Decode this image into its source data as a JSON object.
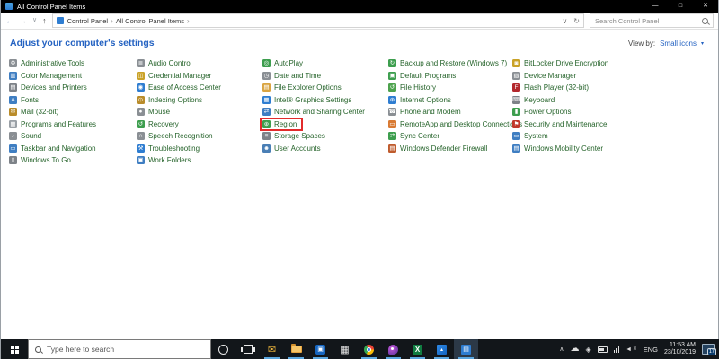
{
  "titlebar": {
    "title": "All Control Panel Items"
  },
  "glyphs": {
    "back": "←",
    "forward": "→",
    "nav_dropdown": "∨",
    "up": "↑",
    "address_dropdown": "∨",
    "refresh": "↻",
    "crumb_sep": "›",
    "minimize": "—",
    "maximize": "□",
    "close": "✕",
    "view_caret": "▾",
    "tray_chevron": "∧"
  },
  "addressbar": {
    "crumbs": [
      "Control Panel",
      "All Control Panel Items"
    ],
    "search_placeholder": "Search Control Panel"
  },
  "header": {
    "title": "Adjust your computer's settings",
    "view_by_label": "View by:",
    "view_by_value": "Small icons"
  },
  "colors": {
    "item_text": "#25632a",
    "link_blue": "#2563c2",
    "highlight_red": "#e22b2b",
    "running_indicator": "#5ba7e0",
    "taskbar_bg": "#12161a"
  },
  "panel": {
    "highlighted": "Region",
    "columns": [
      {
        "items": [
          {
            "label": "Administrative Tools",
            "icon": "administrative-tools-icon"
          },
          {
            "label": "Color Management",
            "icon": "color-management-icon"
          },
          {
            "label": "Devices and Printers",
            "icon": "devices-and-printers-icon"
          },
          {
            "label": "Fonts",
            "icon": "fonts-icon"
          },
          {
            "label": "Mail (32-bit)",
            "icon": "mail-32bit-icon"
          },
          {
            "label": "Programs and Features",
            "icon": "programs-and-features-icon"
          },
          {
            "label": "Sound",
            "icon": "sound-icon"
          },
          {
            "label": "Taskbar and Navigation",
            "icon": "taskbar-navigation-icon"
          },
          {
            "label": "Windows To Go",
            "icon": "windows-to-go-icon"
          }
        ]
      },
      {
        "items": [
          {
            "label": "Audio Control",
            "icon": "audio-control-icon"
          },
          {
            "label": "Credential Manager",
            "icon": "credential-manager-icon"
          },
          {
            "label": "Ease of Access Center",
            "icon": "ease-of-access-icon"
          },
          {
            "label": "Indexing Options",
            "icon": "indexing-options-icon"
          },
          {
            "label": "Mouse",
            "icon": "mouse-icon"
          },
          {
            "label": "Recovery",
            "icon": "recovery-icon"
          },
          {
            "label": "Speech Recognition",
            "icon": "speech-recognition-icon"
          },
          {
            "label": "Troubleshooting",
            "icon": "troubleshooting-icon"
          },
          {
            "label": "Work Folders",
            "icon": "work-folders-icon"
          }
        ]
      },
      {
        "items": [
          {
            "label": "AutoPlay",
            "icon": "autoplay-icon"
          },
          {
            "label": "Date and Time",
            "icon": "date-and-time-icon"
          },
          {
            "label": "File Explorer Options",
            "icon": "file-explorer-options-icon"
          },
          {
            "label": "Intel® Graphics Settings",
            "icon": "intel-graphics-icon"
          },
          {
            "label": "Network and Sharing Center",
            "icon": "network-sharing-icon"
          },
          {
            "label": "Region",
            "icon": "region-icon"
          },
          {
            "label": "Storage Spaces",
            "icon": "storage-spaces-icon"
          },
          {
            "label": "User Accounts",
            "icon": "user-accounts-icon"
          }
        ]
      },
      {
        "items": [
          {
            "label": "Backup and Restore (Windows 7)",
            "icon": "backup-restore-icon"
          },
          {
            "label": "Default Programs",
            "icon": "default-programs-icon"
          },
          {
            "label": "File History",
            "icon": "file-history-icon"
          },
          {
            "label": "Internet Options",
            "icon": "internet-options-icon"
          },
          {
            "label": "Phone and Modem",
            "icon": "phone-modem-icon"
          },
          {
            "label": "RemoteApp and Desktop Connections",
            "icon": "remoteapp-icon"
          },
          {
            "label": "Sync Center",
            "icon": "sync-center-icon"
          },
          {
            "label": "Windows Defender Firewall",
            "icon": "defender-firewall-icon"
          }
        ]
      },
      {
        "items": [
          {
            "label": "BitLocker Drive Encryption",
            "icon": "bitlocker-icon"
          },
          {
            "label": "Device Manager",
            "icon": "device-manager-icon"
          },
          {
            "label": "Flash Player (32-bit)",
            "icon": "flash-player-icon"
          },
          {
            "label": "Keyboard",
            "icon": "keyboard-icon"
          },
          {
            "label": "Power Options",
            "icon": "power-options-icon"
          },
          {
            "label": "Security and Maintenance",
            "icon": "security-maintenance-icon"
          },
          {
            "label": "System",
            "icon": "system-icon"
          },
          {
            "label": "Windows Mobility Center",
            "icon": "mobility-center-icon"
          }
        ]
      }
    ]
  },
  "taskbar": {
    "search_placeholder": "Type here to search",
    "apps": [
      {
        "name": "cortana",
        "icon": "cortana-icon",
        "running": false,
        "active": false
      },
      {
        "name": "task-view",
        "icon": "task-view-icon",
        "running": false,
        "active": false
      },
      {
        "name": "mail",
        "icon": "mail-app-icon",
        "running": true,
        "active": false
      },
      {
        "name": "file-explorer",
        "icon": "file-explorer-icon",
        "running": true,
        "active": false
      },
      {
        "name": "store",
        "icon": "microsoft-store-icon",
        "running": true,
        "active": false
      },
      {
        "name": "calculator",
        "icon": "calculator-icon",
        "running": false,
        "active": false
      },
      {
        "name": "chrome",
        "icon": "chrome-icon",
        "running": true,
        "active": false
      },
      {
        "name": "paint3d",
        "icon": "paint-3d-icon",
        "running": true,
        "active": false
      },
      {
        "name": "excel",
        "icon": "excel-icon",
        "running": true,
        "active": false
      },
      {
        "name": "photos",
        "icon": "photos-icon",
        "running": true,
        "active": false
      },
      {
        "name": "control-panel",
        "icon": "control-panel-taskbar-icon",
        "running": true,
        "active": true
      }
    ],
    "tray": {
      "language": "ENG",
      "time": "11:53 AM",
      "date": "23/10/2019",
      "badge": "17"
    }
  }
}
